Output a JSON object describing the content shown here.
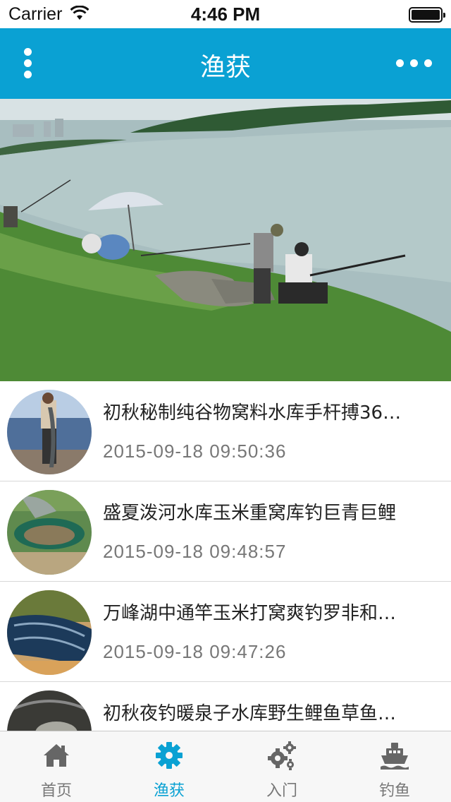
{
  "status_bar": {
    "carrier": "Carrier",
    "time": "4:46 PM"
  },
  "nav": {
    "title": "渔获",
    "left_icon": "vertical-dots-icon",
    "right_icon": "more-dots-icon"
  },
  "banner": {
    "image": "photo of anglers fishing on a lakeshore with an umbrella",
    "page_count": 1,
    "current_page": 1
  },
  "articles": [
    {
      "title": "初秋秘制纯谷物窝料水库手杆搏36…",
      "time": "2015-09-18 09:50:36",
      "thumb": "angler holding large fish"
    },
    {
      "title": "盛夏泼河水库玉米重窝库钓巨青巨鲤",
      "time": "2015-09-18 09:48:57",
      "thumb": "carp in landing net"
    },
    {
      "title": "万峰湖中通竿玉米打窝爽钓罗非和…",
      "time": "2015-09-18 09:47:26",
      "thumb": "keep net full of fish"
    },
    {
      "title": "初秋夜钓暖泉子水库野生鲤鱼草鱼…",
      "time": "",
      "thumb": "fish in net"
    }
  ],
  "tabs": [
    {
      "label": "首页",
      "icon": "home-icon",
      "active": false
    },
    {
      "label": "渔获",
      "icon": "gear-icon",
      "active": true
    },
    {
      "label": "入门",
      "icon": "gears-icon",
      "active": false
    },
    {
      "label": "钓鱼",
      "icon": "ship-icon",
      "active": false
    }
  ],
  "colors": {
    "accent": "#0aa1d3",
    "tab_inactive": "#777777",
    "icon_inactive": "#666666"
  }
}
